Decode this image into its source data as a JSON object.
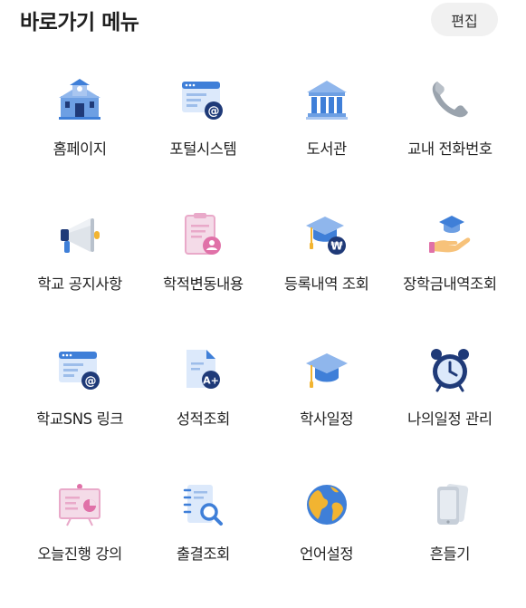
{
  "header": {
    "title": "바로가기 메뉴",
    "edit_label": "편집"
  },
  "menu": [
    {
      "label": "홈페이지",
      "icon": "school-building-icon"
    },
    {
      "label": "포털시스템",
      "icon": "browser-email-icon"
    },
    {
      "label": "도서관",
      "icon": "library-building-icon"
    },
    {
      "label": "교내 전화번호",
      "icon": "phone-icon"
    },
    {
      "label": "학교 공지사항",
      "icon": "megaphone-icon"
    },
    {
      "label": "학적변동내용",
      "icon": "clipboard-person-icon"
    },
    {
      "label": "등록내역 조회",
      "icon": "graduation-cap-won-icon"
    },
    {
      "label": "장학금내역조회",
      "icon": "hand-graduation-cap-icon"
    },
    {
      "label": "학교SNS 링크",
      "icon": "browser-email-icon"
    },
    {
      "label": "성적조회",
      "icon": "grade-document-icon"
    },
    {
      "label": "학사일정",
      "icon": "graduation-cap-icon"
    },
    {
      "label": "나의일정 관리",
      "icon": "alarm-clock-icon"
    },
    {
      "label": "오늘진행 강의",
      "icon": "presentation-board-icon"
    },
    {
      "label": "출결조회",
      "icon": "notebook-search-icon"
    },
    {
      "label": "언어설정",
      "icon": "globe-icon"
    },
    {
      "label": "흔들기",
      "icon": "phone-shake-icon"
    }
  ],
  "colors": {
    "primary_blue": "#3f7fd8",
    "dark_navy": "#1f3a78",
    "pink_accent": "#e071a8",
    "gold_accent": "#f2b431",
    "button_bg": "#f1f1f1"
  }
}
